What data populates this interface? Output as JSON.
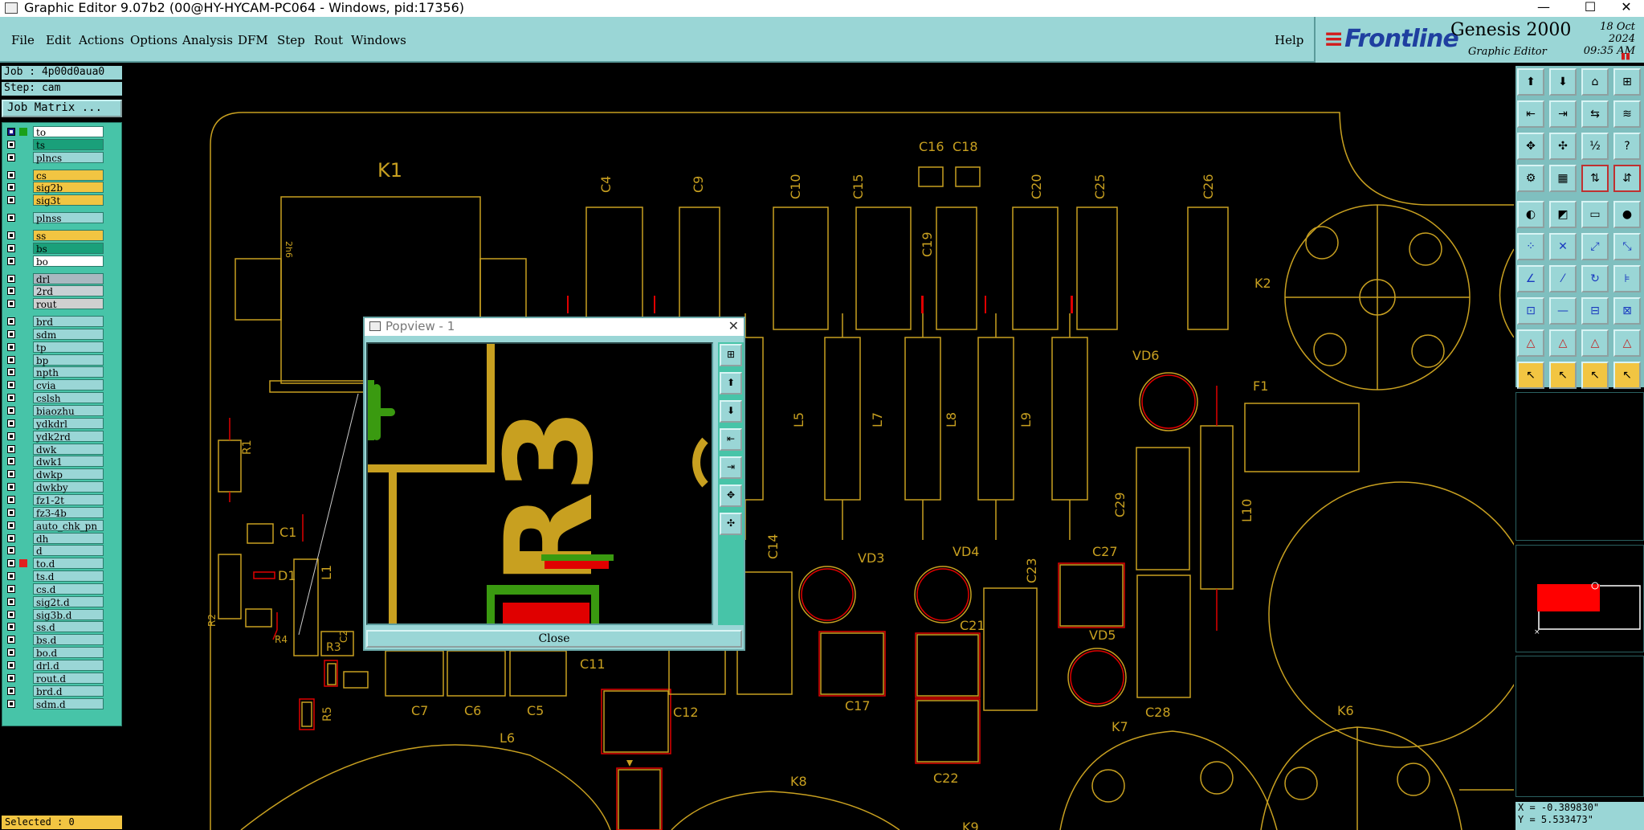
{
  "window": {
    "title": "Graphic Editor 9.07b2 (00@HY-HYCAM-PC064 - Windows, pid:17356)",
    "minimize": "—",
    "maximize": "☐",
    "close": "✕"
  },
  "menu": [
    "File",
    "Edit",
    "Actions",
    "Options",
    "Analysis",
    "DFM",
    "Step",
    "Rout",
    "Windows"
  ],
  "help": "Help",
  "brand": {
    "logo": "Frontline",
    "product": "Genesis 2000",
    "subtitle": "Graphic Editor",
    "date": "18 Oct 2024",
    "time": "09:35 AM"
  },
  "job": {
    "job_line": "Job : 4p00d0aua0",
    "step_line": "Step: cam",
    "matrix_button": "Job Matrix ..."
  },
  "layers": [
    {
      "name": "to",
      "color": "#ffffff",
      "dot": "#1aa01a",
      "checked": true
    },
    {
      "name": "ts",
      "color": "#1aa07a",
      "dot": "",
      "checked": false
    },
    {
      "name": "plncs",
      "color": "#9ad6d6",
      "dot": "",
      "checked": false
    },
    {
      "name": "cs",
      "color": "#f2c542",
      "dot": "",
      "checked": false
    },
    {
      "name": "sig2b",
      "color": "#f2c542",
      "dot": "",
      "checked": false
    },
    {
      "name": "sig3t",
      "color": "#f2c542",
      "dot": "",
      "checked": false
    },
    {
      "name": "plnss",
      "color": "#9ad6d6",
      "dot": "",
      "checked": false
    },
    {
      "name": "ss",
      "color": "#f2c542",
      "dot": "",
      "checked": false
    },
    {
      "name": "bs",
      "color": "#1aa07a",
      "dot": "",
      "checked": false
    },
    {
      "name": "bo",
      "color": "#ffffff",
      "dot": "",
      "checked": false
    },
    {
      "name": "drl",
      "color": "#a9b8c0",
      "dot": "",
      "checked": false
    },
    {
      "name": "2rd",
      "color": "#c8d0d4",
      "dot": "",
      "checked": false
    },
    {
      "name": "rout",
      "color": "#d0d0d0",
      "dot": "",
      "checked": false
    },
    {
      "name": "brd",
      "color": "#9ad6d6",
      "dot": "",
      "checked": false
    },
    {
      "name": "sdm",
      "color": "#9ad6d6",
      "dot": "",
      "checked": false
    },
    {
      "name": "tp",
      "color": "#9ad6d6",
      "dot": "",
      "checked": false
    },
    {
      "name": "bp",
      "color": "#9ad6d6",
      "dot": "",
      "checked": false
    },
    {
      "name": "npth",
      "color": "#9ad6d6",
      "dot": "",
      "checked": false
    },
    {
      "name": "cvia",
      "color": "#9ad6d6",
      "dot": "",
      "checked": false
    },
    {
      "name": "cslsh",
      "color": "#9ad6d6",
      "dot": "",
      "checked": false
    },
    {
      "name": "biaozhu",
      "color": "#9ad6d6",
      "dot": "",
      "checked": false
    },
    {
      "name": "ydkdrl",
      "color": "#9ad6d6",
      "dot": "",
      "checked": false
    },
    {
      "name": "ydk2rd",
      "color": "#9ad6d6",
      "dot": "",
      "checked": false
    },
    {
      "name": "dwk",
      "color": "#9ad6d6",
      "dot": "",
      "checked": false
    },
    {
      "name": "dwk1",
      "color": "#9ad6d6",
      "dot": "",
      "checked": false
    },
    {
      "name": "dwkp",
      "color": "#9ad6d6",
      "dot": "",
      "checked": false
    },
    {
      "name": "dwkby",
      "color": "#9ad6d6",
      "dot": "",
      "checked": false
    },
    {
      "name": "fz1-2t",
      "color": "#9ad6d6",
      "dot": "",
      "checked": false
    },
    {
      "name": "fz3-4b",
      "color": "#9ad6d6",
      "dot": "",
      "checked": false
    },
    {
      "name": "auto_chk_pn",
      "color": "#9ad6d6",
      "dot": "",
      "checked": false
    },
    {
      "name": "dh",
      "color": "#9ad6d6",
      "dot": "",
      "checked": false
    },
    {
      "name": "d",
      "color": "#9ad6d6",
      "dot": "",
      "checked": false
    },
    {
      "name": "to.d",
      "color": "#9ad6d6",
      "dot": "#e02020",
      "checked": false
    },
    {
      "name": "ts.d",
      "color": "#9ad6d6",
      "dot": "",
      "checked": false
    },
    {
      "name": "cs.d",
      "color": "#9ad6d6",
      "dot": "",
      "checked": false
    },
    {
      "name": "sig2t.d",
      "color": "#9ad6d6",
      "dot": "",
      "checked": false
    },
    {
      "name": "sig3b.d",
      "color": "#9ad6d6",
      "dot": "",
      "checked": false
    },
    {
      "name": "ss.d",
      "color": "#9ad6d6",
      "dot": "",
      "checked": false
    },
    {
      "name": "bs.d",
      "color": "#9ad6d6",
      "dot": "",
      "checked": false
    },
    {
      "name": "bo.d",
      "color": "#9ad6d6",
      "dot": "",
      "checked": false
    },
    {
      "name": "drl.d",
      "color": "#9ad6d6",
      "dot": "",
      "checked": false
    },
    {
      "name": "rout.d",
      "color": "#9ad6d6",
      "dot": "",
      "checked": false
    },
    {
      "name": "brd.d",
      "color": "#9ad6d6",
      "dot": "",
      "checked": false
    },
    {
      "name": "sdm.d",
      "color": "#9ad6d6",
      "dot": "",
      "checked": false
    }
  ],
  "status": {
    "selected": "Selected : 0"
  },
  "coords": {
    "x": "X = -0.389830\"",
    "y": "Y = 5.533473\""
  },
  "popup": {
    "title": "Popview - 1",
    "close_button": "Close",
    "label": "R3"
  },
  "silkscreen_labels": [
    "K1",
    "C4",
    "C9",
    "C10",
    "C15",
    "C16",
    "C18",
    "C19",
    "C20",
    "C25",
    "C26",
    "K2",
    "VD6",
    "F1",
    "L5",
    "L7",
    "L8",
    "L9",
    "C29",
    "L10",
    "R1",
    "C1",
    "D1",
    "L1",
    "R3",
    "R2",
    "R4",
    "R5",
    "C14",
    "VD3",
    "VD4",
    "C23",
    "C27",
    "C21",
    "VD5",
    "C17",
    "C11",
    "C7",
    "C6",
    "C5",
    "C12",
    "L6",
    "K8",
    "C22",
    "K7",
    "C28",
    "K6",
    "K9",
    "C2",
    "2h6"
  ],
  "colors": {
    "silk": "#d4a017",
    "pad_outline": "#c8a020",
    "copper_green": "#3a9a10",
    "copper_red": "#e00000",
    "ui_teal": "#9ad6d6",
    "layer_teal": "#47c4a8",
    "ui_yellow": "#f2c542"
  }
}
